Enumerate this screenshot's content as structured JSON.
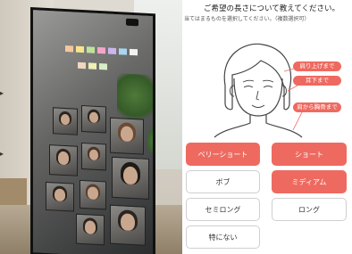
{
  "photo": {
    "description_icon": "mirror-display"
  },
  "app": {
    "question_title": "ご希望の長さについて教えてください。",
    "question_subtitle": "当てはまるものを選択してください。（複数選択可）",
    "length_tags": [
      {
        "label": "肩り上げまで"
      },
      {
        "label": "耳下まで"
      },
      {
        "label": "肩から胸骨まで"
      }
    ],
    "options": [
      {
        "label": "ベリーショート",
        "selected": true
      },
      {
        "label": "ショート",
        "selected": true
      },
      {
        "label": "ボブ",
        "selected": false
      },
      {
        "label": "ミディアム",
        "selected": true
      },
      {
        "label": "セミロング",
        "selected": false
      },
      {
        "label": "ロング",
        "selected": false
      },
      {
        "label": "特にない",
        "selected": false
      }
    ]
  },
  "colors": {
    "accent": "#ee6a60",
    "unselected_border": "#cfcfcf"
  }
}
